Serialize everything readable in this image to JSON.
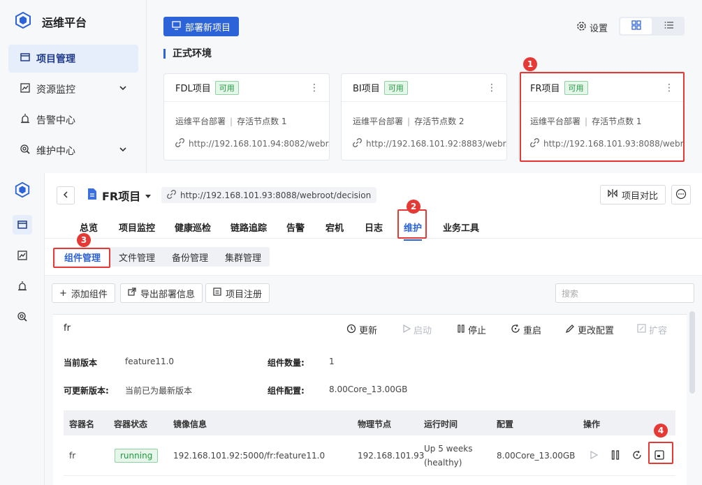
{
  "top": {
    "logo_text": "运维平台",
    "sidebar": [
      {
        "label": "项目管理",
        "icon": "folder-icon",
        "active": true
      },
      {
        "label": "资源监控",
        "icon": "chart-icon"
      },
      {
        "label": "告警中心",
        "icon": "alarm-icon"
      },
      {
        "label": "维护中心",
        "icon": "wrench-icon"
      }
    ],
    "deploy_label": "部署新项目",
    "settings_label": "设置",
    "env_title": "正式环境",
    "cards": [
      {
        "name": "FDL项目",
        "badge": "可用",
        "info": "运维平台部署",
        "nodes": "存活节点数 1",
        "url": "http://192.168.101.94:8082/webr..."
      },
      {
        "name": "BI项目",
        "badge": "可用",
        "info": "运维平台部署",
        "nodes": "存活节点数 2",
        "url": "http://192.168.101.92:8883/webr..."
      },
      {
        "name": "FR项目",
        "badge": "可用",
        "info": "运维平台部署",
        "nodes": "存活节点数 1",
        "url": "http://192.168.101.93:8088/webr..."
      }
    ]
  },
  "markers": [
    "1",
    "2",
    "3",
    "4"
  ],
  "detail": {
    "project_name": "FR项目",
    "project_url": "http://192.168.101.93:8088/webroot/decision",
    "compare_label": "项目对比",
    "tabs": [
      "总览",
      "项目监控",
      "健康巡检",
      "链路追踪",
      "告警",
      "宕机",
      "日志",
      "维护",
      "业务工具"
    ],
    "subtabs": [
      "组件管理",
      "文件管理",
      "备份管理",
      "集群管理"
    ],
    "toolbar": {
      "add": "添加组件",
      "export": "导出部署信息",
      "register": "项目注册",
      "search_placeholder": "搜索"
    },
    "component": {
      "name": "fr",
      "actions": [
        "更新",
        "启动",
        "停止",
        "重启",
        "更改配置",
        "扩容"
      ],
      "current_version_label": "当前版本",
      "current_version": "feature11.0",
      "updatable_label": "可更新版本:",
      "updatable": "当前已为最新版本",
      "count_label": "组件数量:",
      "count": "1",
      "config_label": "组件配置:",
      "config": "8.00Core_13.00GB"
    },
    "table": {
      "headers": [
        "容器名",
        "容器状态",
        "镜像信息",
        "物理节点",
        "运行时间",
        "配置",
        "操作"
      ],
      "row": {
        "name": "fr",
        "status": "running",
        "image": "192.168.101.92:5000/fr:feature11.0",
        "node": "192.168.101.93",
        "uptime_1": "Up 5 weeks",
        "uptime_2": "(healthy)",
        "config": "8.00Core_13.00GB"
      }
    }
  },
  "colors": {
    "accent": "#2d63d8",
    "marker": "#e53935",
    "ok": "#1a9a3c"
  }
}
